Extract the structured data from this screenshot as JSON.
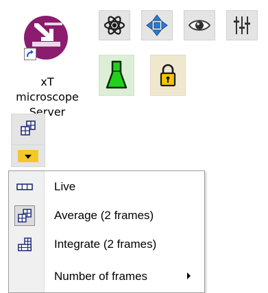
{
  "desktop": {
    "shortcut": {
      "label_lines": [
        "xT",
        "microscope",
        "Server"
      ],
      "icon": "download-arrow-icon",
      "icon_color": "#8b1c6e",
      "shortcut_badge": "shortcut-arrow-icon"
    }
  },
  "toolbar": {
    "row1": [
      {
        "name": "atom-icon"
      },
      {
        "name": "move-arrows-icon"
      },
      {
        "name": "eye-icon"
      },
      {
        "name": "sliders-icon"
      }
    ],
    "row2": [
      {
        "name": "beaker-icon",
        "color": "#22cc22"
      },
      {
        "name": "lock-icon",
        "color": "#f2c400"
      }
    ]
  },
  "scan_mode_button": {
    "icon": "average-frames-icon",
    "dropdown_color": "#f5c728"
  },
  "menu": {
    "items": [
      {
        "label": "Live",
        "icon": "live-icon",
        "checked": false
      },
      {
        "label": "Average (2 frames)",
        "icon": "average-icon",
        "checked": true
      },
      {
        "label": "Integrate (2 frames)",
        "icon": "integrate-icon",
        "checked": false
      },
      {
        "label": "Number of frames",
        "icon": "",
        "checked": false,
        "has_submenu": true
      }
    ]
  }
}
